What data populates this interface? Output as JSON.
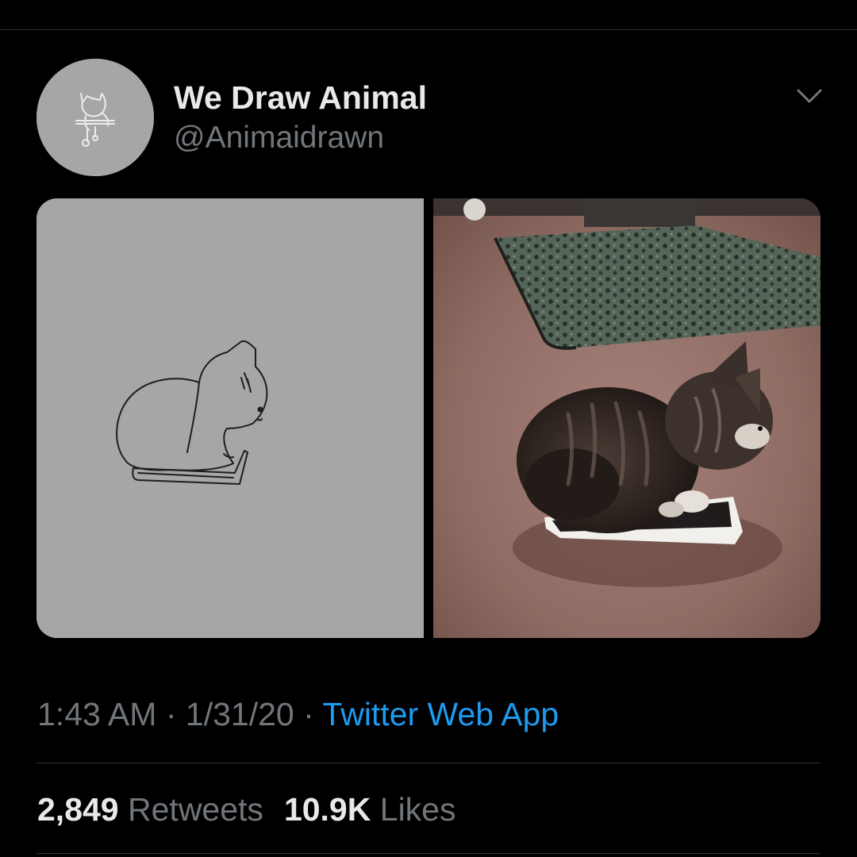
{
  "tweet": {
    "author": {
      "display_name": "We Draw Animal",
      "handle": "@Animaidrawn",
      "avatar_icon": "cat-drawing-avatar"
    },
    "menu_icon": "chevron-down-icon",
    "media": [
      {
        "kind": "drawing",
        "subject": "cat-loaf-on-phone-drawing"
      },
      {
        "kind": "photo",
        "subject": "kitten-on-phone-photo"
      }
    ],
    "meta": {
      "time": "1:43 AM",
      "separator": "·",
      "date": "1/31/20",
      "source": "Twitter Web App"
    },
    "stats": {
      "retweets_count": "2,849",
      "retweets_label": "Retweets",
      "likes_count": "10.9K",
      "likes_label": "Likes"
    }
  },
  "colors": {
    "background": "#000000",
    "primary_text": "#e7e9ea",
    "secondary_text": "#71767b",
    "link": "#1d9bf0",
    "divider": "#2f3336",
    "avatar_bg": "#a6a6a6"
  }
}
